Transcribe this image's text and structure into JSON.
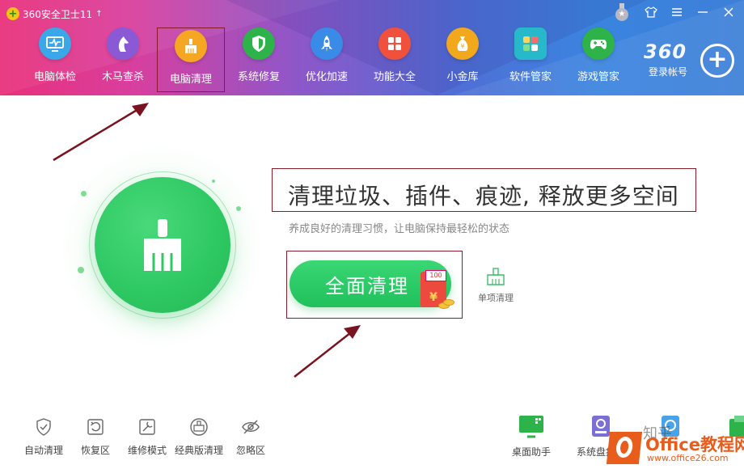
{
  "window": {
    "title": "360安全卫士11",
    "update_arrow": "↑",
    "controls": [
      "medal-icon",
      "shirt-icon",
      "menu-icon",
      "minimize-icon",
      "close-icon"
    ]
  },
  "nav": {
    "items": [
      {
        "label": "电脑体检",
        "icon": "monitor-icon",
        "color": "#3aa7e8"
      },
      {
        "label": "木马查杀",
        "icon": "horse-icon",
        "color": "#8a5ad6"
      },
      {
        "label": "电脑清理",
        "icon": "broom-icon",
        "color": "#f5a623",
        "active": true
      },
      {
        "label": "系统修复",
        "icon": "shield-icon",
        "color": "#2db34a"
      },
      {
        "label": "优化加速",
        "icon": "rocket-icon",
        "color": "#3a8be8"
      },
      {
        "label": "功能大全",
        "icon": "grid-icon",
        "color": "#f0513d"
      },
      {
        "label": "小金库",
        "icon": "money-bag-icon",
        "color": "#f2a81d"
      },
      {
        "label": "软件管家",
        "icon": "apps-icon",
        "color": "#27b9c9"
      },
      {
        "label": "游戏管家",
        "icon": "gamepad-icon",
        "color": "#2db34a"
      }
    ]
  },
  "account": {
    "logo": "360",
    "login_label": "登录帐号"
  },
  "main": {
    "headline": "清理垃圾、插件、痕迹, 释放更多空间",
    "subline": "养成良好的清理习惯，让电脑保持最轻松的状态",
    "clean_button": "全面清理",
    "hongbao_note": "100",
    "hongbao_symbol": "¥",
    "single_clean": "单项清理"
  },
  "bottom_left": [
    {
      "label": "自动清理",
      "icon": "auto-clean-shield-icon"
    },
    {
      "label": "恢复区",
      "icon": "restore-icon"
    },
    {
      "label": "维修模式",
      "icon": "repair-icon"
    },
    {
      "label": "经典版清理",
      "icon": "classic-clean-icon"
    },
    {
      "label": "忽略区",
      "icon": "ignore-eye-icon"
    }
  ],
  "bottom_right": [
    {
      "label": "桌面助手",
      "icon": "desktop-assistant-icon",
      "color": "#2db34a"
    },
    {
      "label": "系统盘瘦身",
      "icon": "disk-slim-icon",
      "color": "#7b6fd6"
    },
    {
      "label": "",
      "icon": "file-icon",
      "color": "#4aa3e8"
    },
    {
      "label": "",
      "icon": "folder-icon",
      "color": "#2db34a"
    }
  ],
  "watermarks": {
    "zhihu": "知乎",
    "brand_en": "Office",
    "brand_cn": "教程网",
    "url": "www.office26.com"
  },
  "colors": {
    "header_start": "#e9307a",
    "header_end": "#3d7fd8",
    "green": "#2fc964",
    "highlight_box": "#8a1b2a"
  }
}
